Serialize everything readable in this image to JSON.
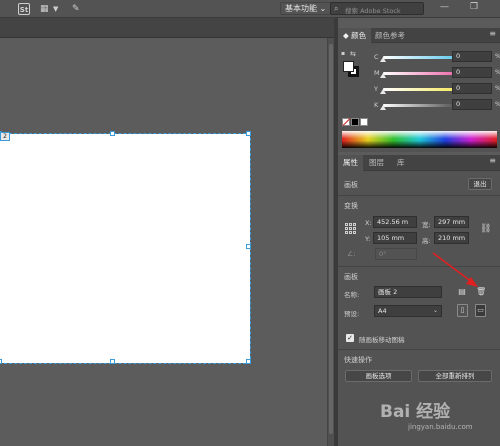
{
  "appbar": {
    "st_label": "St",
    "workspace_label": "基本功能",
    "workspace_caret": "⌄",
    "search_placeholder": "搜索 Adobe Stock",
    "minimize": "—",
    "restore": "❐"
  },
  "artboard_tag": "2",
  "color_panel": {
    "tabs": [
      "颜色",
      "颜色参考"
    ],
    "menu": "≡",
    "channels": [
      {
        "label": "C",
        "value": "0",
        "unit": "%",
        "gradient": [
          "#ffffff",
          "#26b6e8"
        ]
      },
      {
        "label": "M",
        "value": "0",
        "unit": "%",
        "gradient": [
          "#ffffff",
          "#e8308c"
        ]
      },
      {
        "label": "Y",
        "value": "0",
        "unit": "%",
        "gradient": [
          "#ffffff",
          "#f0e020"
        ]
      },
      {
        "label": "K",
        "value": "0",
        "unit": "%",
        "gradient": [
          "#ffffff",
          "#101010"
        ]
      }
    ]
  },
  "props_panel": {
    "tabs": [
      "属性",
      "图层",
      "库"
    ],
    "menu": "≡",
    "artboard_section": "画板",
    "exit_button": "退出",
    "transform_section": "变换",
    "x_label": "X:",
    "x_value": "452.56 m",
    "y_label": "Y:",
    "y_value": "105 mm",
    "w_label": "宽:",
    "w_value": "297 mm",
    "h_label": "高:",
    "h_value": "210 mm",
    "angle_value": "0°",
    "artboard_section2": "画板",
    "name_label": "名称:",
    "name_value": "画板 2",
    "preset_label": "预设:",
    "preset_value": "A4",
    "move_with_artboard": "随画板移动图稿",
    "quick_actions": "快速操作",
    "artboard_options": "画板选项",
    "rearrange_all": "全部重新排列"
  },
  "watermark": {
    "logo": "Bai 经验",
    "url": "jingyan.baidu.com"
  },
  "colors": {
    "accent_selection": "#3a9bd8",
    "annotation_arrow": "#e02020"
  }
}
